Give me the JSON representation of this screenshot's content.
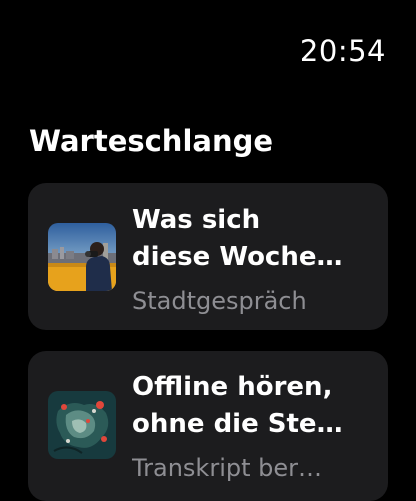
{
  "status": {
    "time": "20:54"
  },
  "queue": {
    "title": "Warteschlange",
    "items": [
      {
        "title_line1": "Was sich",
        "title_line2": "diese Woche…",
        "subtitle": "Stadtgespräch",
        "artwork_icon": "city-podcast-artwork"
      },
      {
        "title_line1": "Offline hören,",
        "title_line2": "ohne die Ste…",
        "subtitle": "Transkript ber…",
        "artwork_icon": "map-podcast-artwork"
      }
    ]
  },
  "colors": {
    "background": "#000000",
    "card": "#1c1c1e",
    "secondary_text": "#8e8e93"
  }
}
